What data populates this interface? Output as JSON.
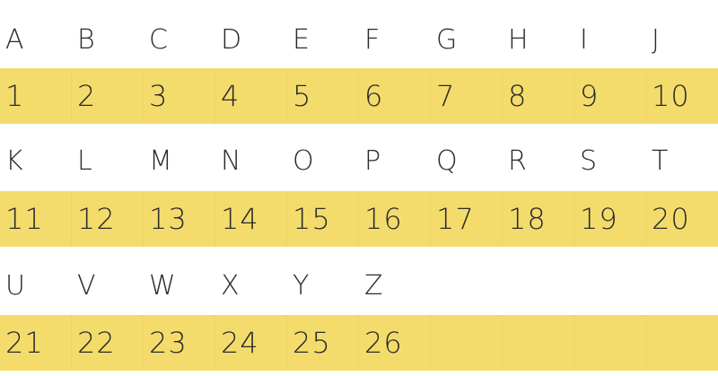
{
  "rows": [
    {
      "letters": [
        "A",
        "B",
        "C",
        "D",
        "E",
        "F",
        "G",
        "H",
        "I",
        "J"
      ],
      "numbers": [
        "1",
        "2",
        "3",
        "4",
        "5",
        "6",
        "7",
        "8",
        "9",
        "10"
      ]
    },
    {
      "letters": [
        "K",
        "L",
        "M",
        "N",
        "O",
        "P",
        "Q",
        "R",
        "S",
        "T"
      ],
      "numbers": [
        "11",
        "12",
        "13",
        "14",
        "15",
        "16",
        "17",
        "18",
        "19",
        "20"
      ]
    },
    {
      "letters": [
        "U",
        "V",
        "W",
        "X",
        "Y",
        "Z"
      ],
      "numbers": [
        "21",
        "22",
        "23",
        "24",
        "25",
        "26"
      ]
    }
  ],
  "colors": {
    "highlight": "#f4dc6c",
    "text": "#2b2b2b",
    "background": "#ffffff"
  }
}
